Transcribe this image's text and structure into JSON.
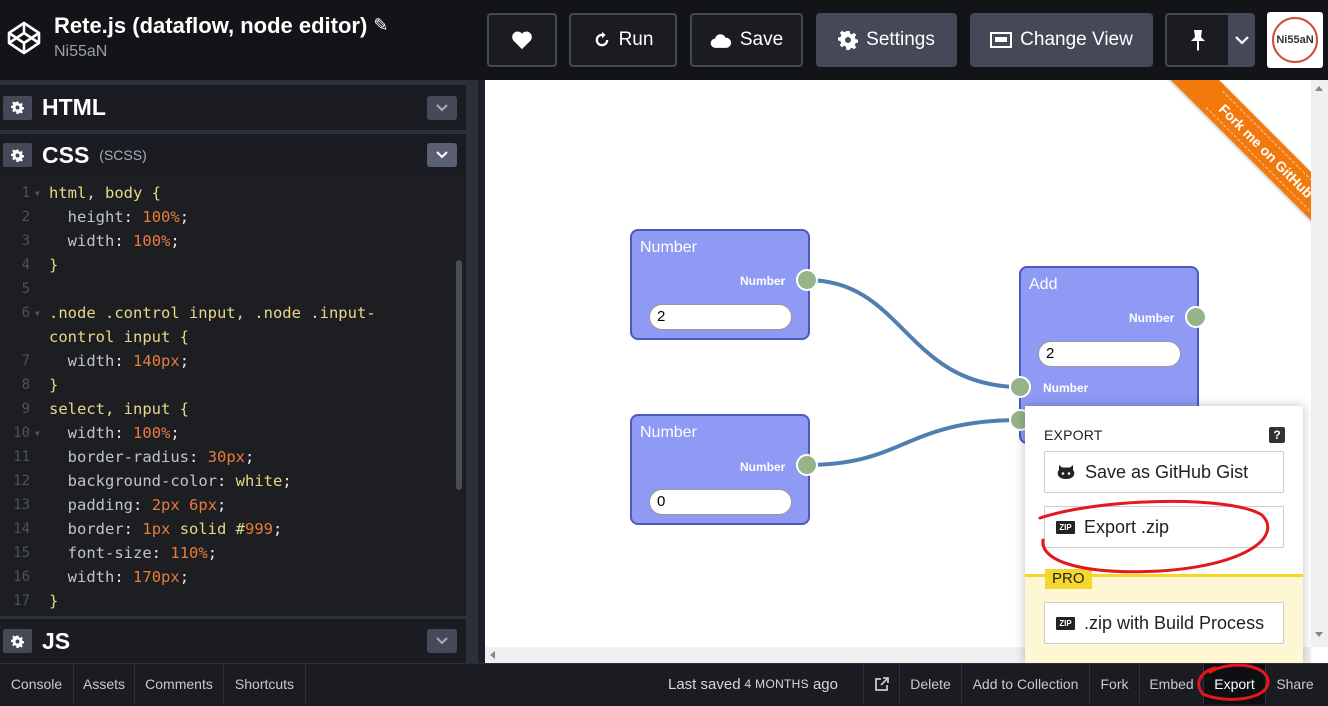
{
  "header": {
    "title": "Rete.js (dataflow, node editor)",
    "author": "Ni55aN",
    "buttons": {
      "run": "Run",
      "save": "Save",
      "settings": "Settings",
      "change_view": "Change View"
    },
    "avatar_text": "Ni55aN"
  },
  "panels": {
    "html": {
      "name": "HTML"
    },
    "css": {
      "name": "CSS",
      "sub": "(SCSS)"
    },
    "js": {
      "name": "JS"
    }
  },
  "code": {
    "line_numbers": [
      "1",
      "2",
      "3",
      "4",
      "5",
      "6",
      "",
      "7",
      "8",
      "9",
      "10",
      "11",
      "12",
      "13",
      "14",
      "15",
      "16",
      "17"
    ],
    "lines": [
      "html, body {",
      "  height: 100%;",
      "  width: 100%;",
      "}",
      "",
      ".node .control input, .node .input-",
      "control input {",
      "  width: 140px;",
      "}",
      "select, input {",
      "  width: 100%;",
      "  border-radius: 30px;",
      "  background-color: white;",
      "  padding: 2px 6px;",
      "  border: 1px solid #999;",
      "  font-size: 110%;",
      "  width: 170px;",
      "}"
    ]
  },
  "nodes": {
    "number1": {
      "title": "Number",
      "output_label": "Number",
      "value": "2"
    },
    "number2": {
      "title": "Number",
      "output_label": "Number",
      "value": "0"
    },
    "add": {
      "title": "Add",
      "output_label": "Number",
      "value": "2",
      "input_label": "Number"
    }
  },
  "ribbon": {
    "text": "Fork me on GitHub"
  },
  "export_menu": {
    "heading": "EXPORT",
    "help": "?",
    "gist": "Save as GitHub Gist",
    "zip": "Export .zip",
    "pro_tag": "PRO",
    "zip_build": ".zip with Build Process",
    "zip_icon": "ZIP"
  },
  "footer": {
    "console": "Console",
    "assets": "Assets",
    "comments": "Comments",
    "shortcuts": "Shortcuts",
    "last_saved": "Last saved",
    "saved_time": "4 MONTHS",
    "saved_suffix": "ago",
    "delete": "Delete",
    "add_to_collection": "Add to Collection",
    "fork": "Fork",
    "embed": "Embed",
    "export": "Export",
    "share": "Share"
  },
  "colors": {
    "node_fill": "#8e9af4",
    "node_border": "#4e58bf",
    "socket": "#96b38a",
    "connection": "#4e7fb0",
    "ribbon": "#f27a0d",
    "pro": "#f3d72d",
    "annotation": "#e3181c"
  }
}
